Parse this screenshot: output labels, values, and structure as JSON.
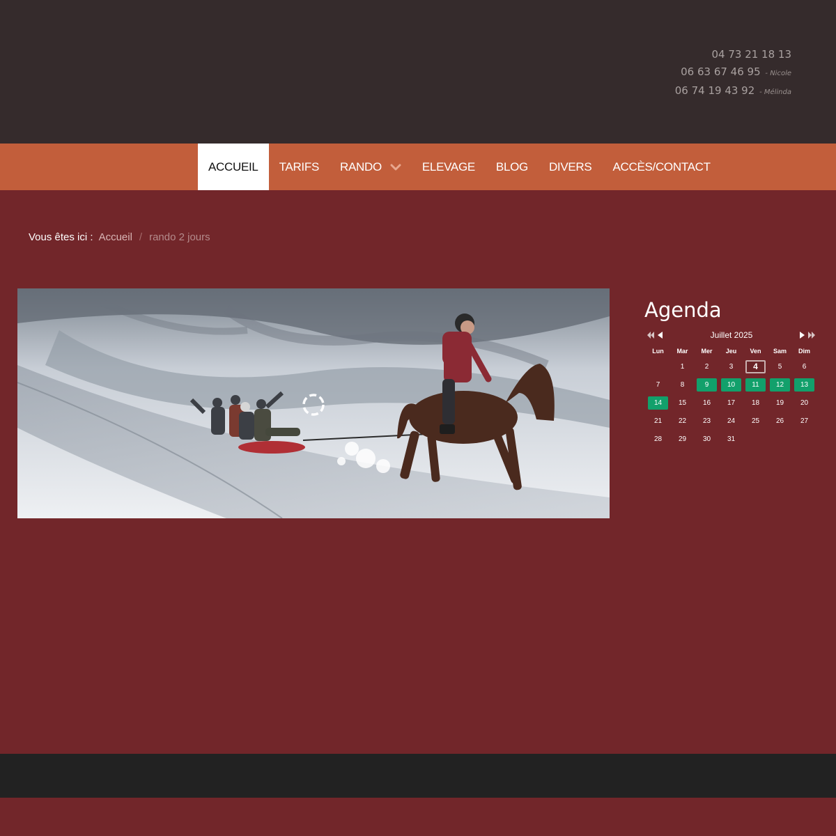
{
  "header": {
    "phones": [
      {
        "number": "04 73 21 18 13",
        "name": ""
      },
      {
        "number": "06 63 67 46 95",
        "name": "- Nicole"
      },
      {
        "number": "06 74 19 43 92",
        "name": "- Mélinda"
      }
    ]
  },
  "nav": {
    "items": [
      {
        "label": "ACCUEIL",
        "active": true
      },
      {
        "label": "TARIFS",
        "active": false
      },
      {
        "label": "RANDO",
        "active": false,
        "dropdown": true
      },
      {
        "label": "ELEVAGE",
        "active": false
      },
      {
        "label": "BLOG",
        "active": false
      },
      {
        "label": "DIVERS",
        "active": false
      },
      {
        "label": "ACCÈS/CONTACT",
        "active": false
      }
    ],
    "colors": {
      "bar": "#c25e3b",
      "active_bg": "#ffffff"
    }
  },
  "breadcrumb": {
    "label": "Vous êtes ici :",
    "home": "Accueil",
    "separator": "/",
    "current": "rando 2 jours"
  },
  "agenda": {
    "title": "Agenda",
    "month": "Juillet 2025",
    "weekdays": [
      "Lun",
      "Mar",
      "Mer",
      "Jeu",
      "Ven",
      "Sam",
      "Dim"
    ],
    "leading_blanks": 1,
    "days": [
      "1",
      "2",
      "3",
      "4",
      "5",
      "6",
      "7",
      "8",
      "9",
      "10",
      "11",
      "12",
      "13",
      "14",
      "15",
      "16",
      "17",
      "18",
      "19",
      "20",
      "21",
      "22",
      "23",
      "24",
      "25",
      "26",
      "27",
      "28",
      "29",
      "30",
      "31"
    ],
    "today": "4",
    "event_days": [
      "9",
      "10",
      "11",
      "12",
      "13",
      "14"
    ],
    "colors": {
      "event": "#12a06b"
    }
  },
  "colors": {
    "page_bg": "#72262a",
    "header_bg": "#352b2c",
    "footer_bg": "#222222"
  }
}
